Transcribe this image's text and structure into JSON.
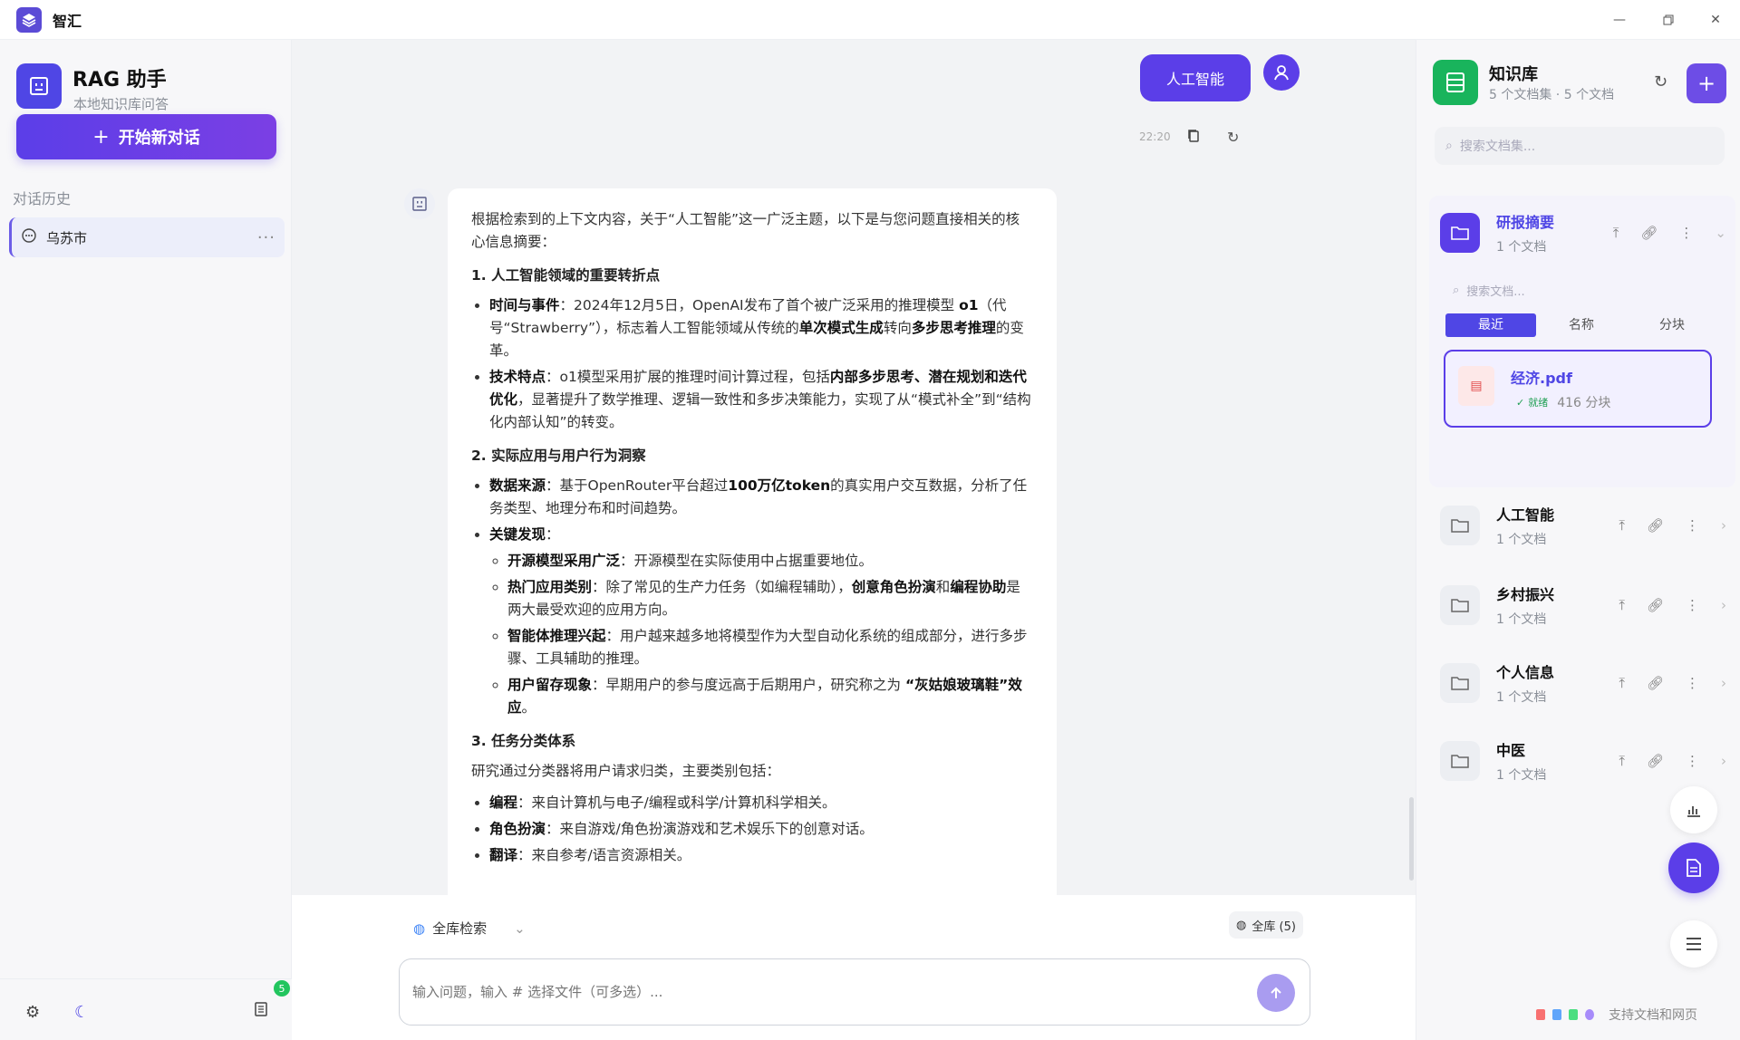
{
  "app": {
    "title": "智汇"
  },
  "sidebar": {
    "assistant_name": "RAG 助手",
    "assistant_sub": "本地知识库问答",
    "new_chat_label": "开始新对话",
    "history_label": "对话历史",
    "history": [
      {
        "title": "乌苏市"
      }
    ],
    "badge_count": "5"
  },
  "chat": {
    "user_message": "人工智能",
    "message_time": "22:20",
    "answer": {
      "intro": "根据检索到的上下文内容，关于“人工智能”这一广泛主题，以下是与您问题直接相关的核心信息摘要：",
      "s1_title": "1. 人工智能领域的重要转折点",
      "s1_i1_label": "时间与事件",
      "s1_i1_a": "：2024年12月5日，OpenAI发布了首个被广泛采用的推理模型 ",
      "s1_i1_b": "o1",
      "s1_i1_c": "（代号“Strawberry”），标志着人工智能领域从传统的",
      "s1_i1_d": "单次模式生成",
      "s1_i1_e": "转向",
      "s1_i1_f": "多步思考推理",
      "s1_i1_g": "的变革。",
      "s1_i2_label": "技术特点",
      "s1_i2_a": "：o1模型采用扩展的推理时间计算过程，包括",
      "s1_i2_b": "内部多步思考、潜在规划和迭代优化",
      "s1_i2_c": "，显著提升了数学推理、逻辑一致性和多步决策能力，实现了从“模式补全”到“结构化内部认知”的转变。",
      "s2_title": "2. 实际应用与用户行为洞察",
      "s2_i1_label": "数据来源",
      "s2_i1_a": "：基于OpenRouter平台超过",
      "s2_i1_b": "100万亿token",
      "s2_i1_c": "的真实用户交互数据，分析了任务类型、地理分布和时间趋势。",
      "s2_i2_label": "关键发现",
      "s2_i2_colon": "：",
      "s2_sub1_label": "开源模型采用广泛",
      "s2_sub1_text": "：开源模型在实际使用中占据重要地位。",
      "s2_sub2_label": "热门应用类别",
      "s2_sub2_a": "：除了常见的生产力任务（如编程辅助），",
      "s2_sub2_b": "创意角色扮演",
      "s2_sub2_c": "和",
      "s2_sub2_d": "编程协助",
      "s2_sub2_e": "是两大最受欢迎的应用方向。",
      "s2_sub3_label": "智能体推理兴起",
      "s2_sub3_text": "：用户越来越多地将模型作为大型自动化系统的组成部分，进行多步骤、工具辅助的推理。",
      "s2_sub4_label": "用户留存现象",
      "s2_sub4_a": "：早期用户的参与度远高于后期用户，研究称之为 ",
      "s2_sub4_b": "“灰姑娘玻璃鞋”效应",
      "s2_sub4_c": "。",
      "s3_title": "3. 任务分类体系",
      "s3_intro": "研究通过分类器将用户请求归类，主要类别包括：",
      "s3_i1_label": "编程",
      "s3_i1_text": "：来自计算机与电子/编程或科学/计算机科学相关。",
      "s3_i2_label": "角色扮演",
      "s3_i2_text": "：来自游戏/角色扮演游戏和艺术娱乐下的创意对话。",
      "s3_i3_label": "翻译",
      "s3_i3_text": "：来自参考/语言资源相关。"
    }
  },
  "composer": {
    "scope_label": "全库检索",
    "scope_pill": "全库 (5)",
    "placeholder": "输入问题，输入 # 选择文件（可多选）..."
  },
  "knowledge": {
    "title": "知识库",
    "subtitle": "5 个文档集 · 5 个文档",
    "search_placeholder": "搜索文档集...",
    "open_collection": {
      "name": "研报摘要",
      "count": "1 个文档",
      "doc_search_placeholder": "搜索文档...",
      "sort_tabs": [
        "最近",
        "名称",
        "分块"
      ],
      "document": {
        "name": "经济.pdf",
        "status": "就绪",
        "chunks": "416 分块"
      }
    },
    "collections": [
      {
        "name": "人工智能",
        "count": "1 个文档"
      },
      {
        "name": "乡村振兴",
        "count": "1 个文档"
      },
      {
        "name": "个人信息",
        "count": "1 个文档"
      },
      {
        "name": "中医",
        "count": "1 个文档"
      }
    ],
    "footer": "支持文档和网页"
  },
  "colors": {
    "accent": "#5b3ee8",
    "kb_green": "#19b45c",
    "ready_green": "#22a055"
  }
}
